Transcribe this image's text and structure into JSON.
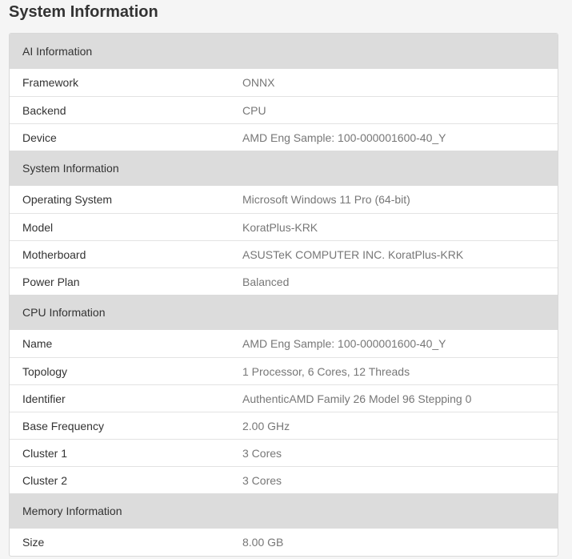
{
  "page": {
    "title": "System Information"
  },
  "sections": [
    {
      "title": "AI Information",
      "rows": [
        {
          "key": "Framework",
          "value": "ONNX"
        },
        {
          "key": "Backend",
          "value": "CPU"
        },
        {
          "key": "Device",
          "value": "AMD Eng Sample: 100-000001600-40_Y"
        }
      ]
    },
    {
      "title": "System Information",
      "rows": [
        {
          "key": "Operating System",
          "value": "Microsoft Windows 11 Pro (64-bit)"
        },
        {
          "key": "Model",
          "value": "KoratPlus-KRK"
        },
        {
          "key": "Motherboard",
          "value": "ASUSTeK COMPUTER INC. KoratPlus-KRK"
        },
        {
          "key": "Power Plan",
          "value": "Balanced"
        }
      ]
    },
    {
      "title": "CPU Information",
      "rows": [
        {
          "key": "Name",
          "value": "AMD Eng Sample: 100-000001600-40_Y"
        },
        {
          "key": "Topology",
          "value": "1 Processor, 6 Cores, 12 Threads"
        },
        {
          "key": "Identifier",
          "value": "AuthenticAMD Family 26 Model 96 Stepping 0"
        },
        {
          "key": "Base Frequency",
          "value": "2.00 GHz"
        },
        {
          "key": "Cluster 1",
          "value": "3 Cores"
        },
        {
          "key": "Cluster 2",
          "value": "3 Cores"
        }
      ]
    },
    {
      "title": "Memory Information",
      "rows": [
        {
          "key": "Size",
          "value": "8.00 GB"
        }
      ]
    }
  ]
}
